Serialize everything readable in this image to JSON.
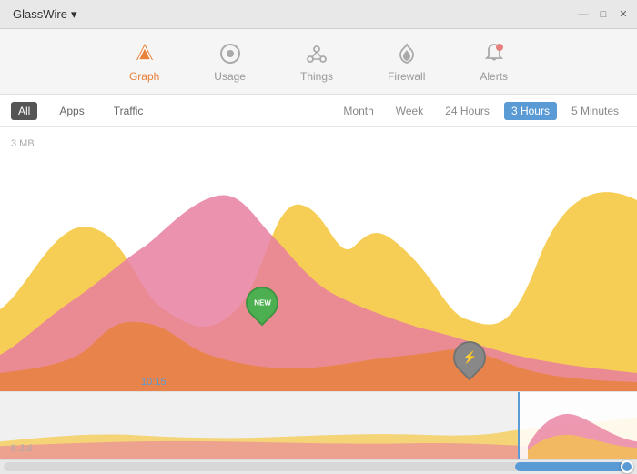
{
  "app": {
    "name": "GlassWire",
    "menu_arrow": "▾"
  },
  "window_controls": {
    "minimize": "—",
    "maximize": "□",
    "close": "✕"
  },
  "nav": {
    "tabs": [
      {
        "id": "graph",
        "label": "Graph",
        "icon": "chart-icon",
        "active": true
      },
      {
        "id": "usage",
        "label": "Usage",
        "icon": "usage-icon",
        "active": false
      },
      {
        "id": "things",
        "label": "Things",
        "icon": "things-icon",
        "active": false
      },
      {
        "id": "firewall",
        "label": "Firewall",
        "icon": "firewall-icon",
        "active": false
      },
      {
        "id": "alerts",
        "label": "Alerts",
        "icon": "alerts-icon",
        "active": false
      }
    ]
  },
  "filters": {
    "left": [
      {
        "id": "all",
        "label": "All",
        "active": true
      },
      {
        "id": "apps",
        "label": "Apps",
        "active": false
      },
      {
        "id": "traffic",
        "label": "Traffic",
        "active": false
      }
    ],
    "right": [
      {
        "id": "month",
        "label": "Month",
        "active": false
      },
      {
        "id": "week",
        "label": "Week",
        "active": false
      },
      {
        "id": "24hours",
        "label": "24 Hours",
        "active": false
      },
      {
        "id": "3hours",
        "label": "3 Hours",
        "active": true
      },
      {
        "id": "5minutes",
        "label": "5 Minutes",
        "active": false
      }
    ]
  },
  "chart": {
    "y_label": "3 MB",
    "time_marker": "10:15",
    "pins": [
      {
        "id": "pin-new",
        "label": "NEW",
        "color": "#4caf50"
      },
      {
        "id": "pin-tor",
        "label": "⚡",
        "color": "#888888"
      }
    ]
  },
  "mini_chart": {
    "date_label": "8 Jul"
  },
  "colors": {
    "accent": "#e8813a",
    "active_tab": "#5b9bd5",
    "yellow": "#f5c842",
    "pink": "#e87fa0",
    "orange": "#e8813a",
    "green": "#4caf50"
  }
}
